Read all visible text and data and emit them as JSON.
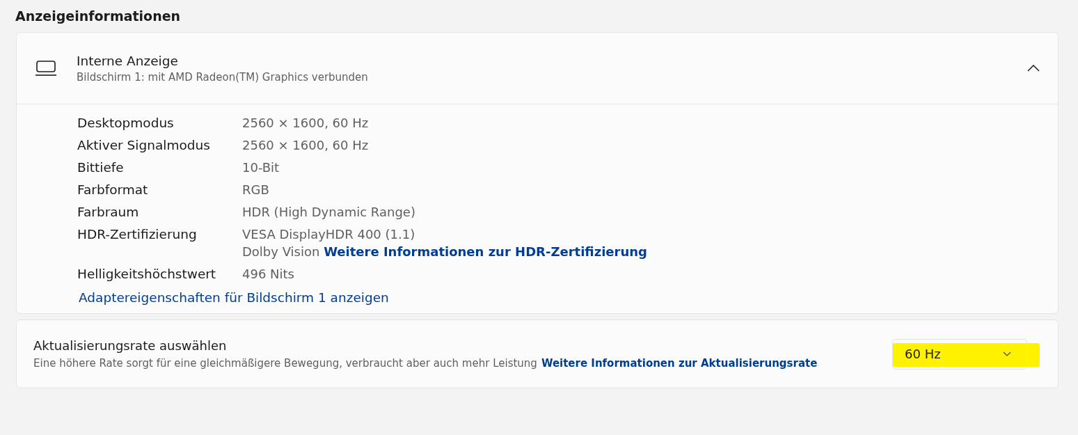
{
  "section_title": "Anzeigeinformationen",
  "display": {
    "name": "Interne Anzeige",
    "subtitle": "Bildschirm 1: mit AMD Radeon(TM) Graphics verbunden",
    "expanded": true,
    "properties": [
      {
        "label": "Desktopmodus",
        "lines": [
          {
            "text": "2560 × 1600, 60 Hz"
          }
        ]
      },
      {
        "label": "Aktiver Signalmodus",
        "lines": [
          {
            "text": "2560 × 1600, 60 Hz"
          }
        ]
      },
      {
        "label": "Bittiefe",
        "lines": [
          {
            "text": "10-Bit"
          }
        ]
      },
      {
        "label": "Farbformat",
        "lines": [
          {
            "text": "RGB"
          }
        ]
      },
      {
        "label": "Farbraum",
        "lines": [
          {
            "text": "HDR (High Dynamic Range)"
          }
        ]
      },
      {
        "label": "HDR-Zertifizierung",
        "lines": [
          {
            "text": "VESA DisplayHDR 400 (1.1)"
          },
          {
            "text": "Dolby Vision",
            "link": "Weitere Informationen zur HDR-Zertifizierung"
          }
        ]
      },
      {
        "label": "Helligkeitshöchstwert",
        "lines": [
          {
            "text": "496 Nits"
          }
        ]
      }
    ],
    "adapter_link": "Adaptereigenschaften für Bildschirm 1 anzeigen"
  },
  "refresh_rate": {
    "title": "Aktualisierungsrate auswählen",
    "description": "Eine höhere Rate sorgt für eine gleichmäßigere Bewegung, verbraucht aber auch mehr Leistung",
    "link": "Weitere Informationen zur Aktualisierungsrate",
    "value": "60 Hz",
    "highlighted": true
  }
}
